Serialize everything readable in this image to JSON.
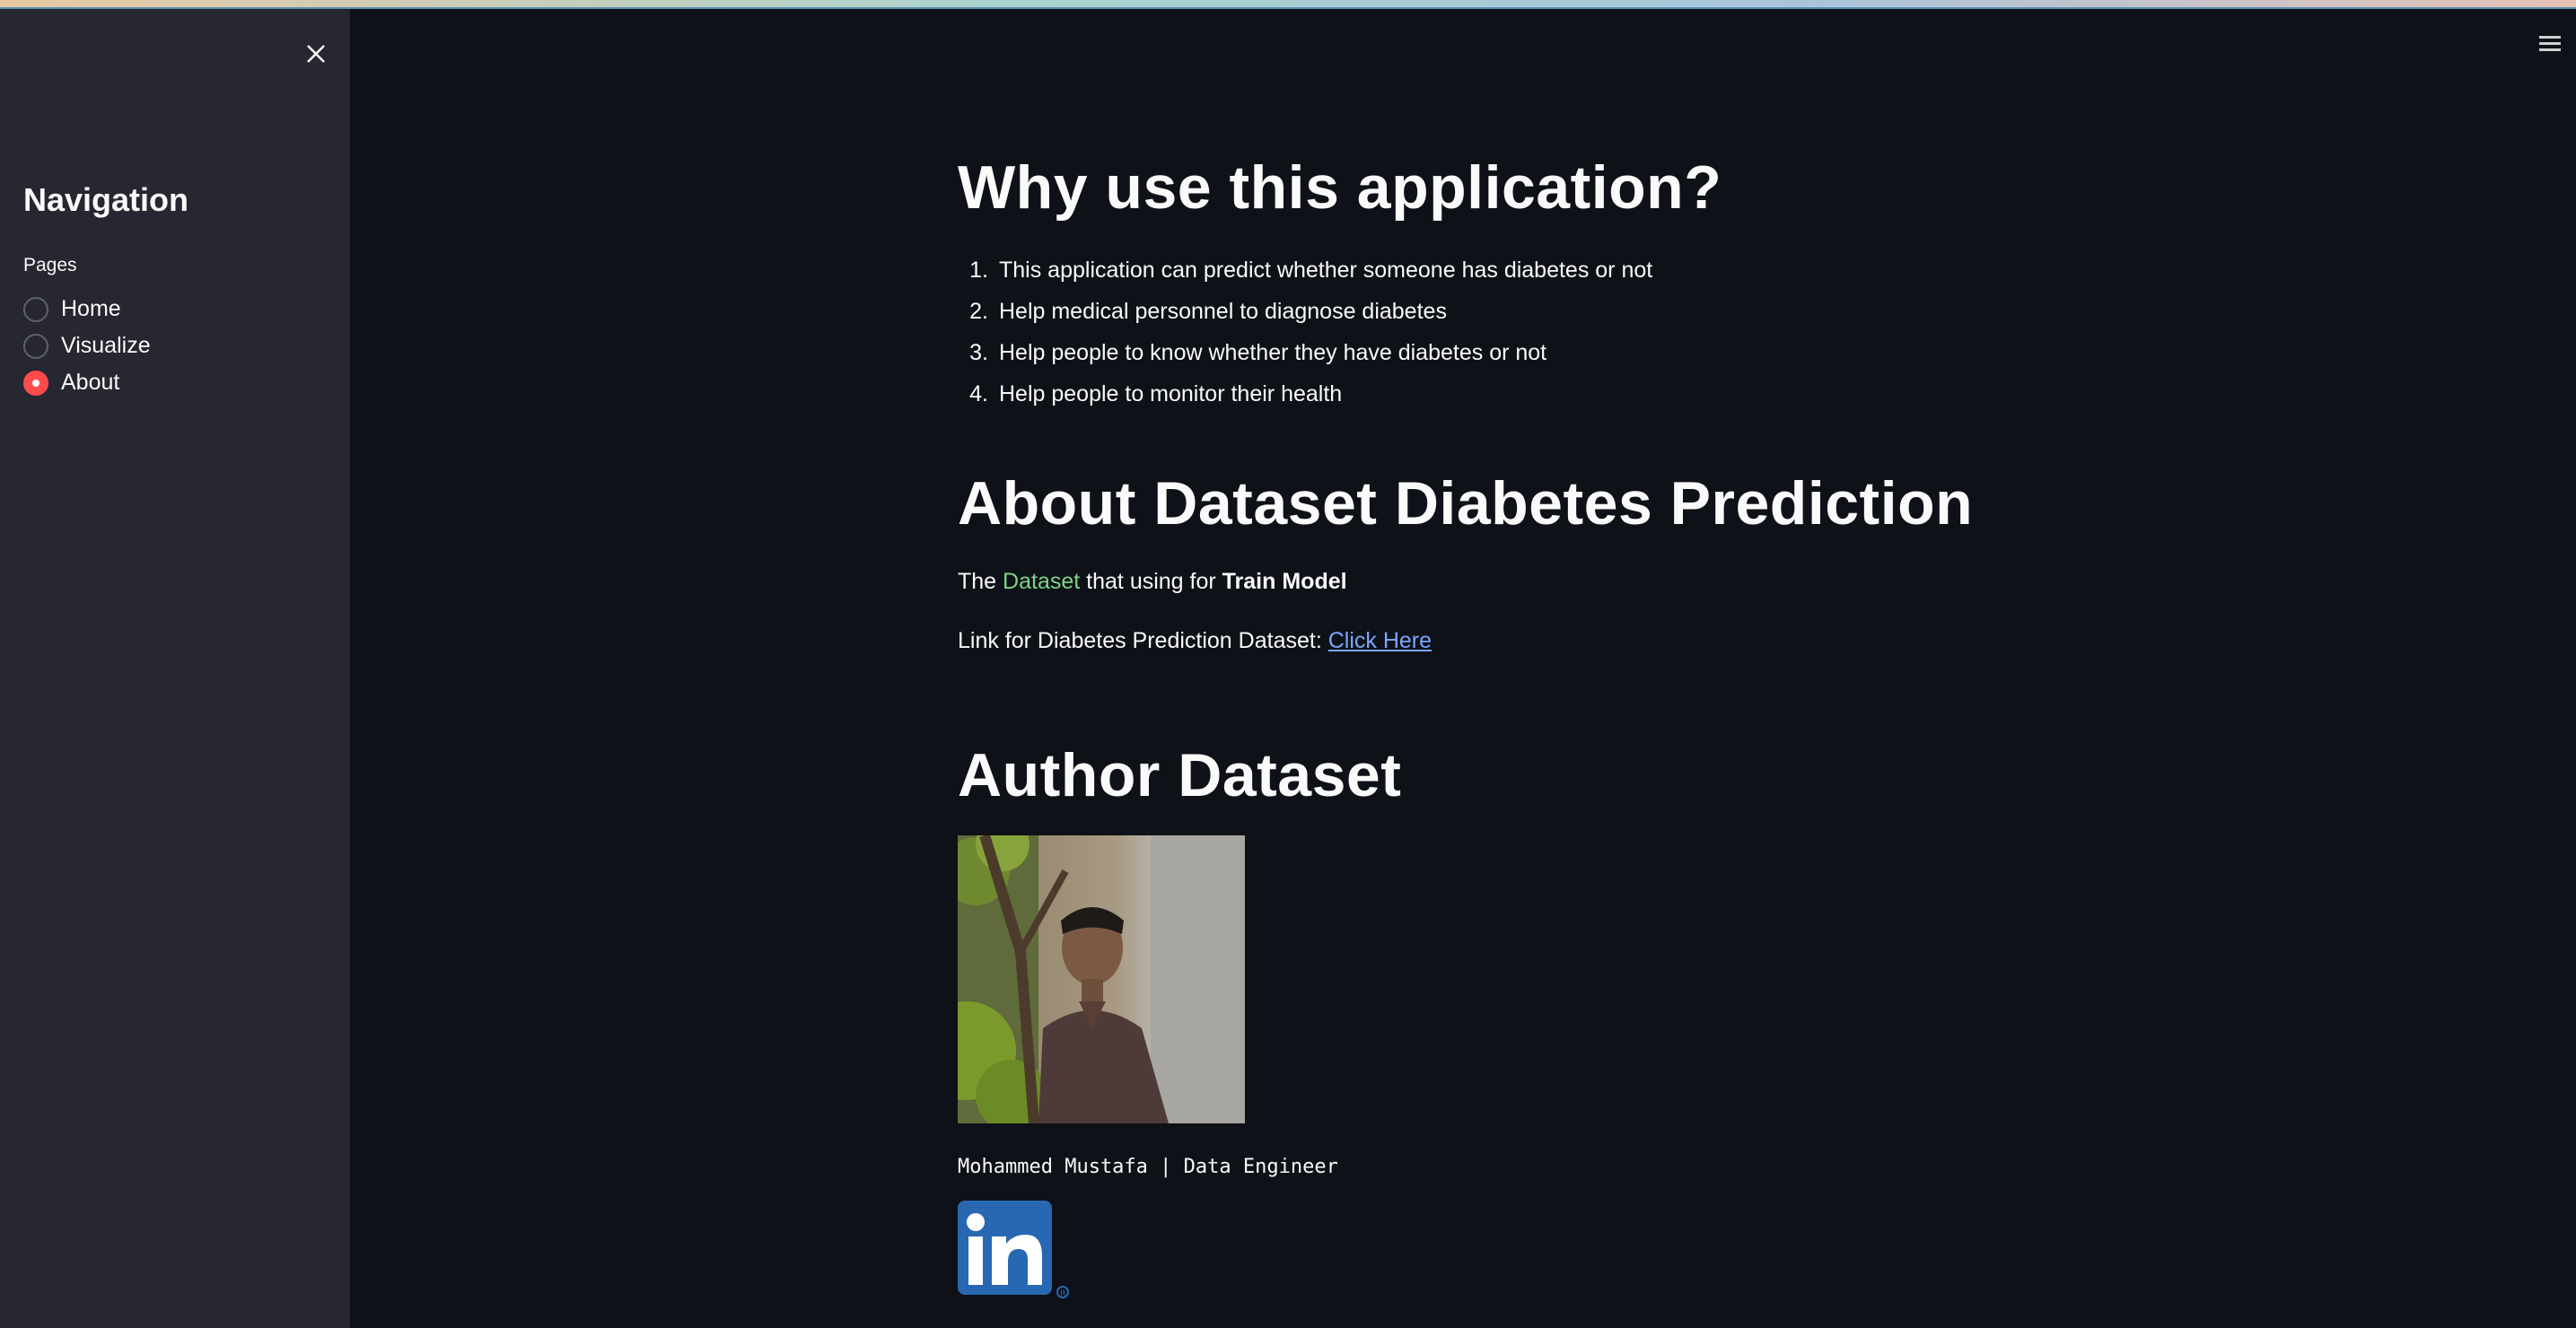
{
  "sidebar": {
    "title": "Navigation",
    "pages_label": "Pages",
    "items": [
      {
        "label": "Home",
        "selected": false
      },
      {
        "label": "Visualize",
        "selected": false
      },
      {
        "label": "About",
        "selected": true
      }
    ]
  },
  "main": {
    "why_heading": "Why use this application?",
    "reasons": [
      {
        "num": "1.",
        "text": "This application can predict whether someone has diabetes or not"
      },
      {
        "num": "2.",
        "text": "Help medical personnel to diagnose diabetes"
      },
      {
        "num": "3.",
        "text": "Help people to know whether they have diabetes or not"
      },
      {
        "num": "4.",
        "text": "Help people to monitor their health"
      }
    ],
    "about_heading": "About Dataset Diabetes Prediction",
    "dataset_line": {
      "prefix": "The",
      "dataset_word": "Dataset",
      "middle": "that using for",
      "bold_end": "Train Model"
    },
    "link_line": {
      "text": "Link for Diabetes Prediction Dataset:",
      "link_text": "Click Here"
    },
    "author_heading": "Author Dataset",
    "author_caption": "Mohammed Mustafa | Data Engineer"
  },
  "colors": {
    "background": "#0e1117",
    "sidebar": "#262730",
    "accent": "#ff4b4b",
    "link": "#7aa6ff",
    "dataset_green": "#7cd38a",
    "linkedin_blue": "#2867b2"
  }
}
